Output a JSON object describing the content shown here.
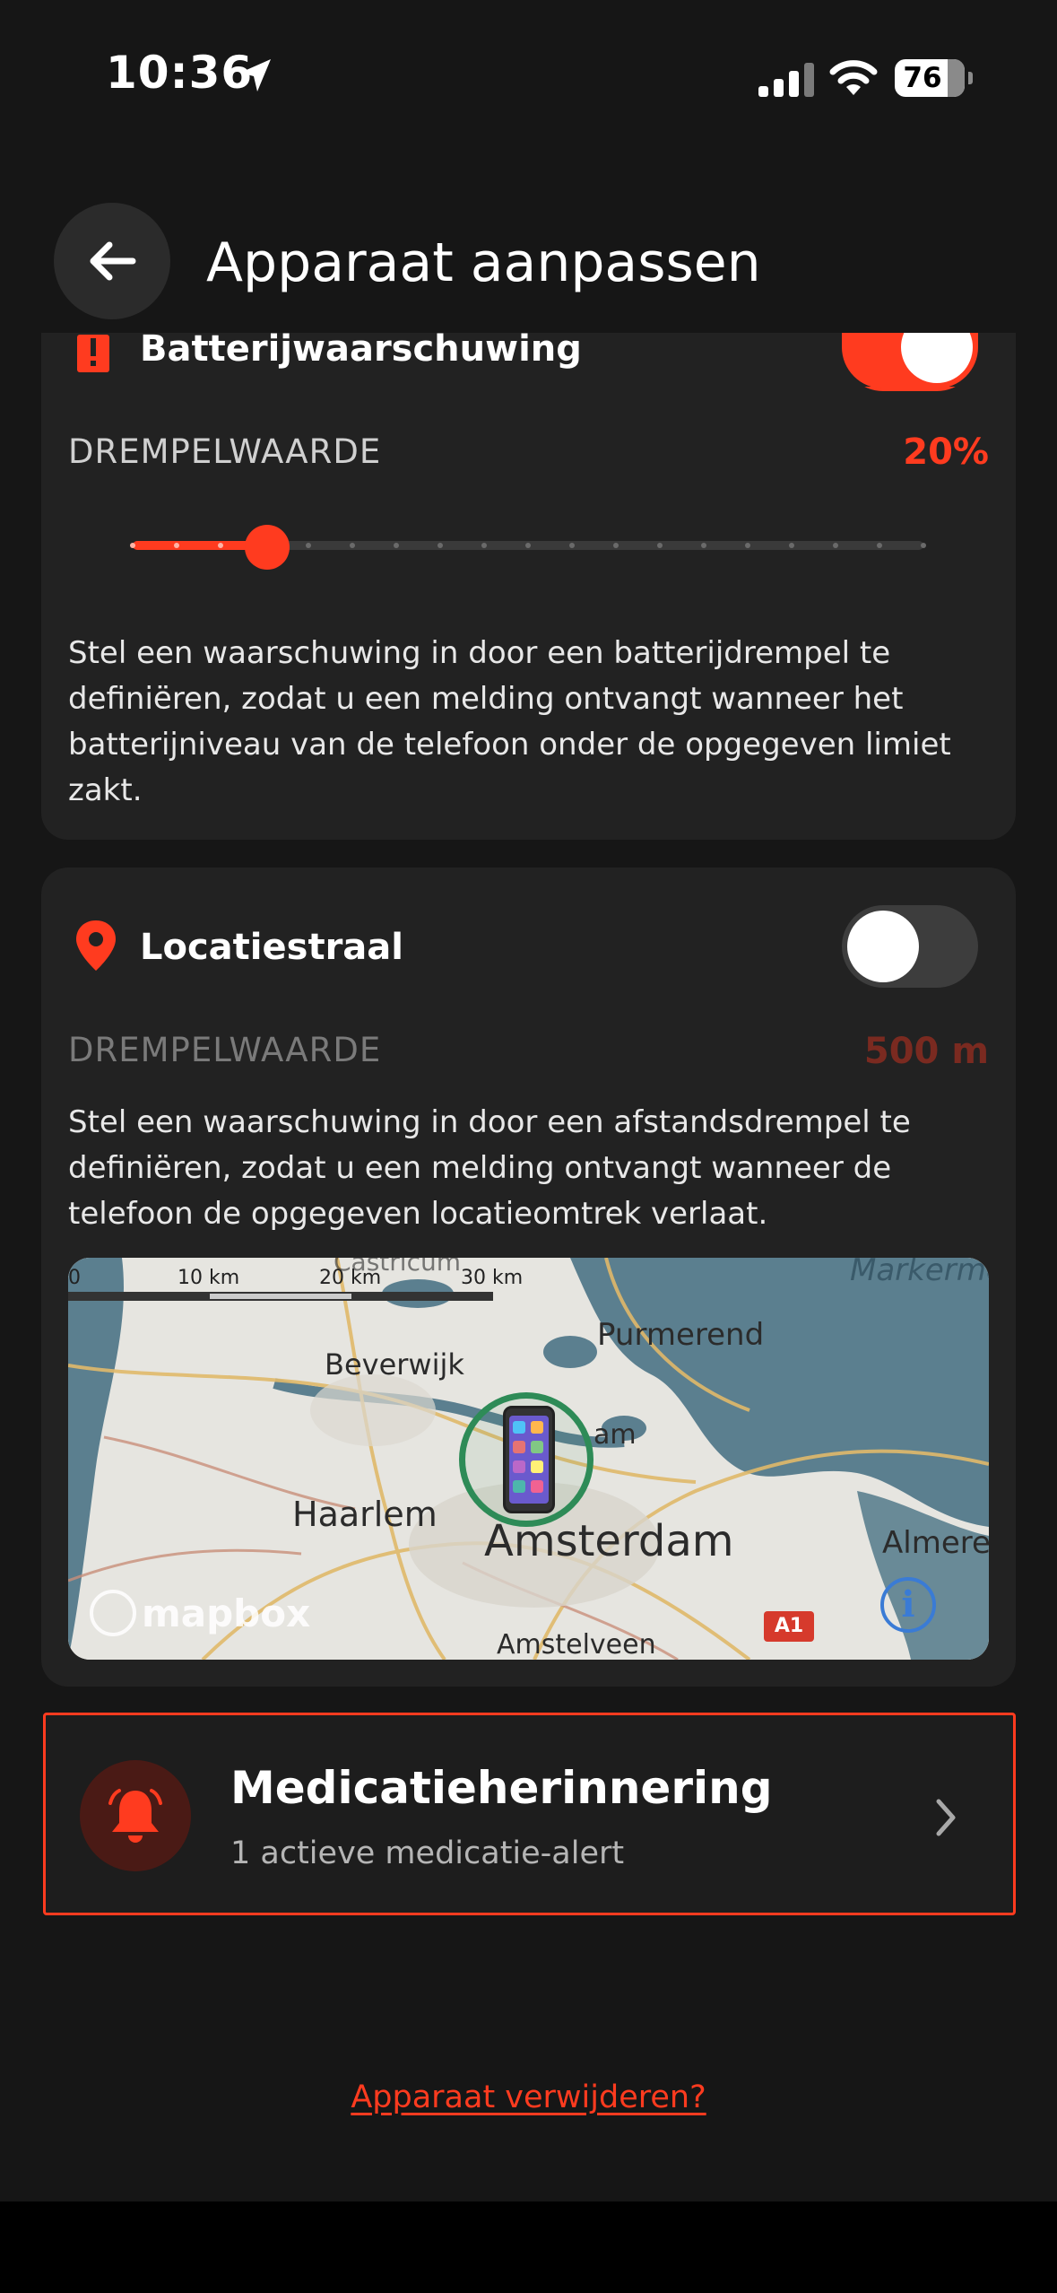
{
  "status_bar": {
    "time": "10:36",
    "battery": "76",
    "cellular_bars": 3,
    "colors": {
      "status_icons": "#ffffff"
    }
  },
  "header": {
    "title": "Apparaat aanpassen",
    "back_icon": "arrow-left-icon"
  },
  "battery_warning": {
    "title": "Batterijwaarschuwing",
    "icon": "exclamation-icon",
    "enabled": true,
    "threshold_label": "DREMPELWAARDE",
    "threshold_value": "20%",
    "slider_fraction": 0.17,
    "description": "Stel een waarschuwing in door een batterijdrempel te definiëren, zodat u een melding ontvangt wanneer het batterijniveau van de telefoon onder de opgegeven limiet zakt."
  },
  "location_radius": {
    "title": "Locatiestraal",
    "icon": "location-pin-icon",
    "enabled": false,
    "threshold_label": "DREMPELWAARDE",
    "threshold_value": "500 m",
    "description": "Stel een waarschuwing in door een afstandsdrempel te definiëren, zodat u een melding ontvangt wanneer de telefoon de opgegeven locatieomtrek verlaat.",
    "map": {
      "scale_labels": [
        "0",
        "10 km",
        "20 km",
        "30 km"
      ],
      "places": [
        "Castricum",
        "Purmerend",
        "Beverwijk",
        "Haarlem",
        "Amsterdam",
        "Almere",
        "Amstelveen",
        "Markermeer",
        "am"
      ],
      "road_badge": "A1",
      "attribution": "mapbox",
      "info_icon": "info-icon"
    }
  },
  "medication": {
    "title": "Medicatieherinnering",
    "subtitle": "1 actieve medicatie-alert",
    "icon": "bell-icon",
    "chevron": "chevron-right-icon"
  },
  "delete_link": "Apparaat verwijderen?",
  "colors": {
    "accent": "#ff3b1f",
    "background": "#161616",
    "card": "#222222",
    "dim_accent": "#7a2a20",
    "dim_text": "#8a8a8a"
  }
}
